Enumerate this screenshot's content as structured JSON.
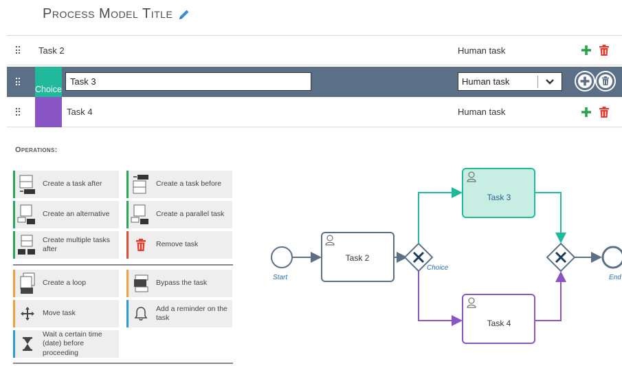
{
  "header": {
    "title": "Process Model Title",
    "edit_icon": "pencil-icon"
  },
  "tasks": [
    {
      "name": "Task 2",
      "type": "Human task"
    },
    {
      "name": "Task 3",
      "type": "Human task",
      "badge": "Choice",
      "badge_color": "#20b99c",
      "selected": true
    },
    {
      "name": "Task 4",
      "type": "Human task",
      "badge_color": "#8a55c4"
    }
  ],
  "operations": {
    "title": "Operations:",
    "items": [
      {
        "label": "Create a task after",
        "icon": "task-after-icon",
        "color": "#2aa55a"
      },
      {
        "label": "Create a task before",
        "icon": "task-before-icon",
        "color": "#2aa55a"
      },
      {
        "label": "Create an alternative",
        "icon": "alternative-icon",
        "color": "#2aa55a"
      },
      {
        "label": "Create a parallel task",
        "icon": "parallel-icon",
        "color": "#2aa55a"
      },
      {
        "label": "Create multiple tasks after",
        "icon": "multiple-tasks-icon",
        "color": "#2aa55a"
      },
      {
        "label": "Remove task",
        "icon": "trash-icon",
        "color": "#e04b3a"
      },
      {
        "label": "Create a loop",
        "icon": "loop-icon",
        "color": "#f0a040"
      },
      {
        "label": "Bypass the task",
        "icon": "bypass-icon",
        "color": "#f0a040"
      },
      {
        "label": "Move task",
        "icon": "move-icon",
        "color": "#f0a040"
      },
      {
        "label": "Add a reminder on the task",
        "icon": "bell-icon",
        "color": "#2b9ad5"
      },
      {
        "label": "Wait a certain time (date) before proceeding",
        "icon": "hourglass-icon",
        "color": "#2b9ad5"
      }
    ]
  },
  "diagram": {
    "start_label": "Start",
    "end_label": "End",
    "gateway_label": "Choice",
    "nodes": [
      "Task 2",
      "Task 3",
      "Task 4"
    ],
    "colors": {
      "choice": "#20b99c",
      "alt": "#8a55c4",
      "main": "#5b7087"
    }
  }
}
